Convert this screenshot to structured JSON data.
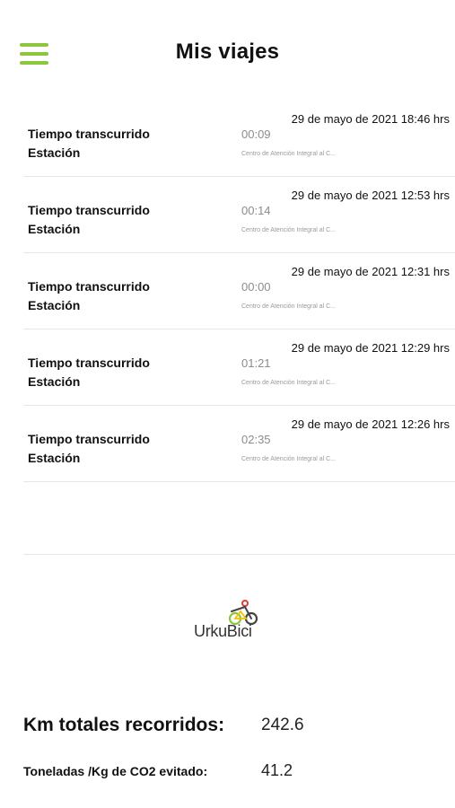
{
  "colors": {
    "accent": "#8cc63f",
    "text": "#111111",
    "muted": "#8c8c8c",
    "divider": "#e6e6e6"
  },
  "header": {
    "menu_icon": "hamburger-menu-icon",
    "title": "Mis viajes"
  },
  "trips": [
    {
      "date": "29 de mayo de 2021 18:46 hrs",
      "time_label": "Tiempo transcurrido",
      "time_value": "00:09",
      "station_label": "Estación",
      "station_value": "Centro de Atención Integral al C..."
    },
    {
      "date": "29 de mayo de 2021 12:53 hrs",
      "time_label": "Tiempo transcurrido",
      "time_value": "00:14",
      "station_label": "Estación",
      "station_value": "Centro de Atención Integral al C..."
    },
    {
      "date": "29 de mayo de 2021 12:31 hrs",
      "time_label": "Tiempo transcurrido",
      "time_value": "00:00",
      "station_label": "Estación",
      "station_value": "Centro de Atención Integral al C..."
    },
    {
      "date": "29 de mayo de 2021 12:29 hrs",
      "time_label": "Tiempo transcurrido",
      "time_value": "01:21",
      "station_label": "Estación",
      "station_value": "Centro de Atención Integral al C..."
    },
    {
      "date": "29 de mayo de 2021 12:26 hrs",
      "time_label": "Tiempo transcurrido",
      "time_value": "02:35",
      "station_label": "Estación",
      "station_value": "Centro de Atención Integral al C..."
    }
  ],
  "logo": {
    "text": "UrkuBici"
  },
  "stats": {
    "km_label": "Km totales recorridos:",
    "km_value": "242.6",
    "co2_label": "Toneladas /Kg de CO2 evitado:",
    "co2_value": "41.2"
  }
}
